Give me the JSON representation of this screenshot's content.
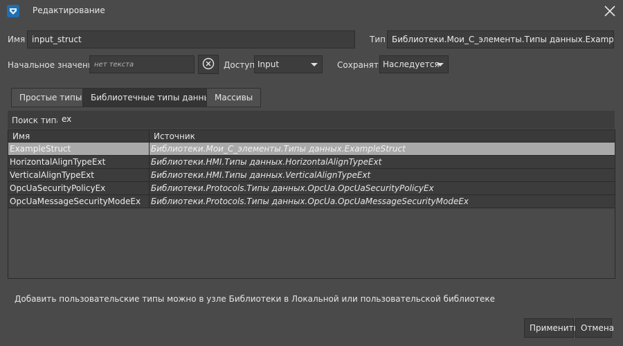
{
  "window": {
    "title": "Редактирование",
    "icon": "app-logo-icon",
    "close_icon": "close-icon"
  },
  "form": {
    "name_label": "Имя",
    "name_value": "input_struct",
    "type_label": "Тип",
    "type_value": "Библиотеки.Мои_С_элементы.Типы данных.ExampleStruct",
    "initial_label": "Начальное значение",
    "initial_placeholder": "нет текста",
    "access_label": "Доступ",
    "access_value": "Input",
    "save_label": "Сохранять",
    "save_value": "Наследуется"
  },
  "tabs": [
    {
      "label": "Простые типы",
      "active": false
    },
    {
      "label": "Библиотечные типы данных",
      "active": true
    },
    {
      "label": "Массивы",
      "active": false
    }
  ],
  "search": {
    "label": "Поиск типа",
    "value": "ex"
  },
  "table": {
    "columns": [
      "Имя",
      "Источник"
    ],
    "rows": [
      {
        "name": "ExampleStruct",
        "source": "Библиотеки.Мои_С_элементы.Типы данных.ExampleStruct",
        "selected": true
      },
      {
        "name": "HorizontalAlignTypeExt",
        "source": "Библиотеки.HMI.Типы данных.HorizontalAlignTypeExt",
        "selected": false
      },
      {
        "name": "VerticalAlignTypeExt",
        "source": "Библиотеки.HMI.Типы данных.VerticalAlignTypeExt",
        "selected": false
      },
      {
        "name": "OpcUaSecurityPolicyEx",
        "source": "Библиотеки.Protocols.Типы данных.OpcUa.OpcUaSecurityPolicyEx",
        "selected": false
      },
      {
        "name": "OpcUaMessageSecurityModeEx",
        "source": "Библиотеки.Protocols.Типы данных.OpcUa.OpcUaMessageSecurityModeEx",
        "selected": false
      }
    ]
  },
  "hint": "Добавить пользовательские типы можно в узле Библиотеки в Локальной или пользовательской библиотеке",
  "buttons": {
    "apply": "Применить",
    "cancel": "Отмена"
  },
  "colors": {
    "background": "#4a4a4a",
    "field": "#3d3d3d",
    "active_tab": "#343434",
    "selected_row": "#a9a9a9",
    "accent_icon": "#1f6fb3"
  }
}
